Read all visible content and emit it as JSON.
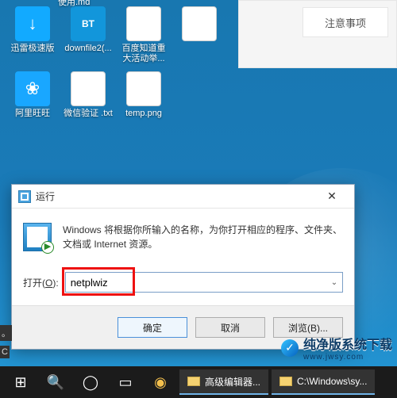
{
  "right_panel": {
    "tab_label": "注意事项"
  },
  "desktop": {
    "top_label": "使用.md",
    "icons": [
      {
        "label": "迅雷极速版",
        "kind": "arrow",
        "glyph": "↓"
      },
      {
        "label": "downfile2(...",
        "kind": "bt",
        "glyph": "BT"
      },
      {
        "label": "百度知道重大活动举...",
        "kind": "txt",
        "glyph": ""
      },
      {
        "label": "",
        "kind": "txt",
        "glyph": ""
      },
      {
        "label": "阿里旺旺",
        "kind": "ww",
        "glyph": "❀"
      },
      {
        "label": "微信验证 .txt",
        "kind": "txt",
        "glyph": ""
      },
      {
        "label": "temp.png",
        "kind": "img",
        "glyph": ""
      }
    ]
  },
  "run": {
    "title": "运行",
    "message": "Windows 将根据你所输入的名称，为你打开相应的程序、文件夹、文档或 Internet 资源。",
    "open_label_pre": "打开(",
    "open_label_u": "O",
    "open_label_post": "):",
    "input_value": "netplwiz",
    "ok": "确定",
    "cancel": "取消",
    "browse": "浏览(B)...",
    "close_glyph": "✕",
    "dropdown_glyph": "⌄"
  },
  "edge_fragments": {
    "a": "。",
    "b": "C"
  },
  "taskbar": {
    "start_glyph": "⊞",
    "search_glyph": "🔍",
    "cortana_glyph": "◯",
    "taskview_glyph": "▭",
    "chrome_glyph": "◉",
    "items": [
      {
        "label": "高级编辑器..."
      },
      {
        "label": "C:\\Windows\\sy..."
      }
    ]
  },
  "watermark": {
    "logo_glyph": "✓",
    "line1": "纯净版系统下载",
    "line2": "www.jwsy.com"
  }
}
